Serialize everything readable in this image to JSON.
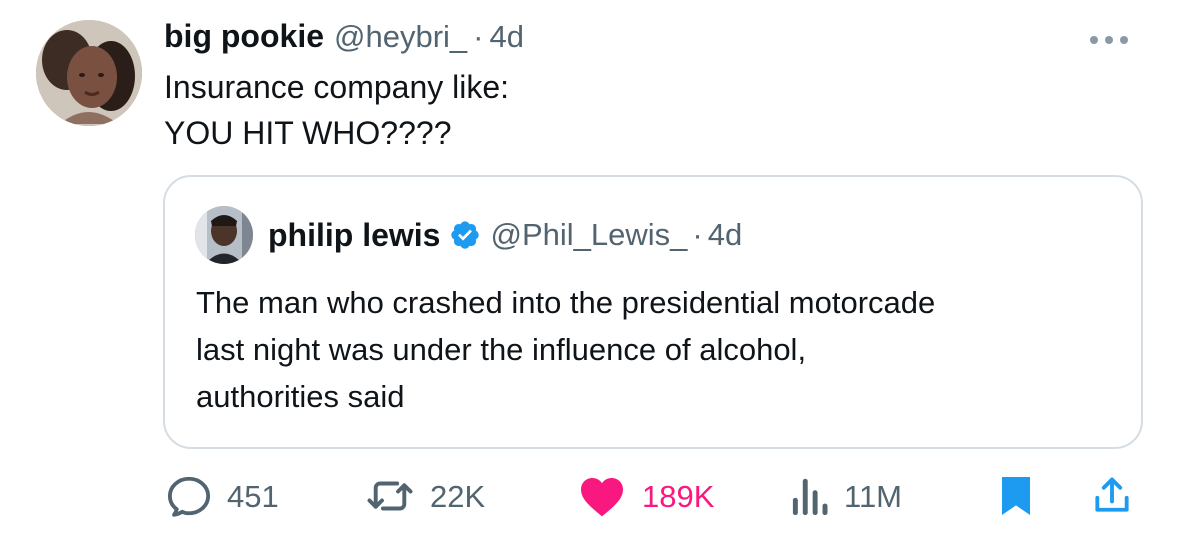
{
  "tweet": {
    "display_name": "big pookie",
    "handle": "@heybri_",
    "separator": "·",
    "time": "4d",
    "text": "Insurance company like:\nYOU HIT WHO????",
    "more_label": "..."
  },
  "quote": {
    "display_name": "philip lewis",
    "handle": "@Phil_Lewis_",
    "separator": "·",
    "time": "4d",
    "verified": true,
    "text": "The man who crashed into the presidential motorcade\nlast night was under the influence of alcohol,\nauthorities said"
  },
  "actions": {
    "reply": {
      "icon": "reply-icon",
      "count": "451"
    },
    "retweet": {
      "icon": "retweet-icon",
      "count": "22K"
    },
    "like": {
      "icon": "heart-icon",
      "count": "189K",
      "active": true,
      "color": "#f91880"
    },
    "views": {
      "icon": "views-icon",
      "count": "11M"
    },
    "bookmark": {
      "icon": "bookmark-icon",
      "active": true,
      "color": "#1d9bf0"
    },
    "share": {
      "icon": "share-icon",
      "color": "#1d9bf0"
    }
  },
  "colors": {
    "text": "#0f1419",
    "muted": "#536471",
    "border": "#d5dde3",
    "accent_blue": "#1d9bf0",
    "like_pink": "#f91880"
  }
}
